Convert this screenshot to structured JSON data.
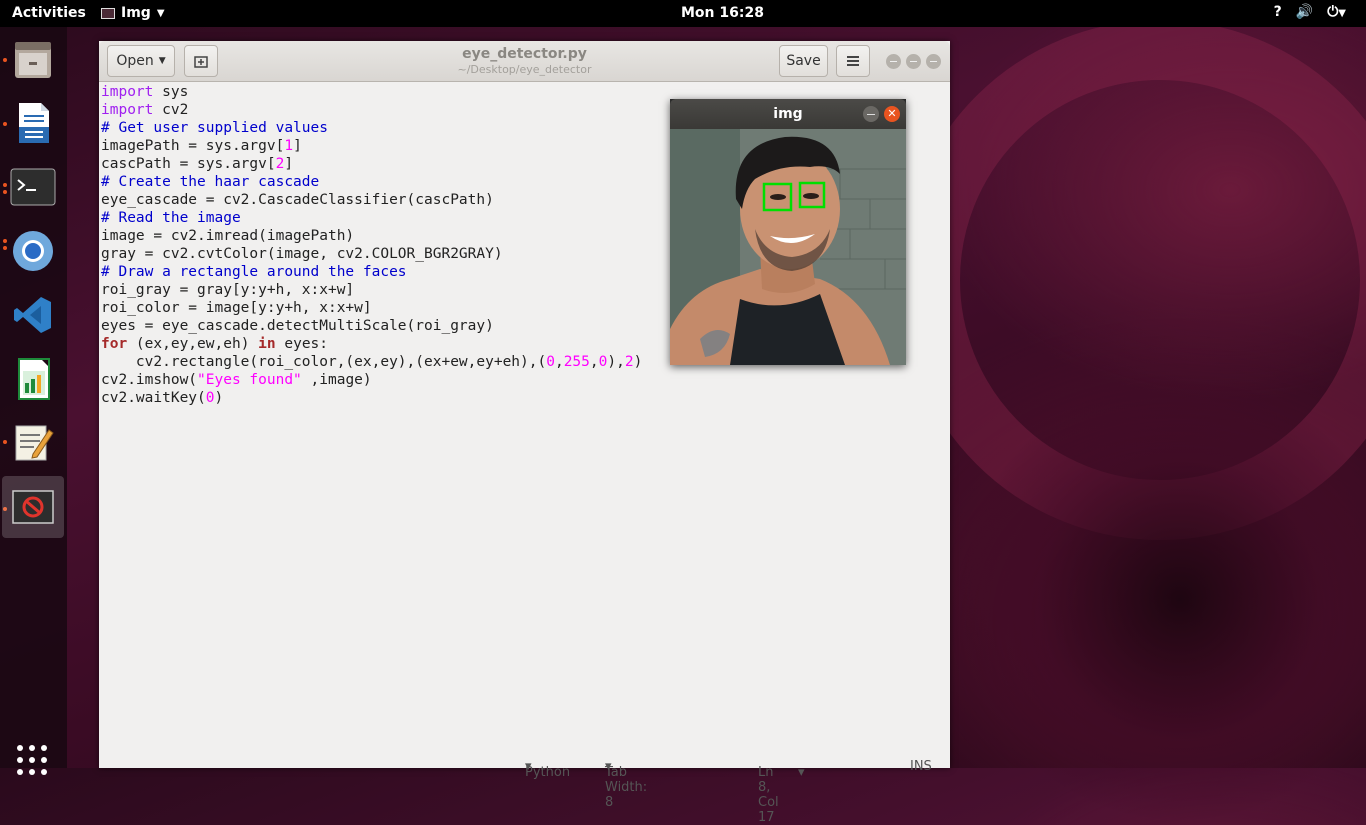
{
  "topbar": {
    "activities": "Activities",
    "app_name": "Img",
    "clock": "Mon 16:28",
    "tray": [
      "?",
      "🔊",
      "⏻"
    ]
  },
  "dock": {
    "apps": [
      "Files",
      "LibreOffice Writer",
      "Terminal",
      "Chromium",
      "Visual Studio Code",
      "LibreOffice Calc",
      "Text Editor",
      "Img"
    ]
  },
  "editor": {
    "open_label": "Open",
    "title": "eye_detector.py",
    "subtitle": "~/Desktop/eye_detector",
    "save_label": "Save",
    "status": {
      "language": "Python",
      "tab_width": "Tab Width: 8",
      "position": "Ln 8, Col 17",
      "mode": "INS"
    }
  },
  "code_lines": [
    [
      {
        "t": "import",
        "c": "kw"
      },
      {
        "t": " sys",
        "c": ""
      }
    ],
    [
      {
        "t": "import",
        "c": "kw"
      },
      {
        "t": " cv2",
        "c": ""
      }
    ],
    [
      {
        "t": "# Get user supplied values",
        "c": "cm"
      }
    ],
    [
      {
        "t": "imagePath = sys.argv[",
        "c": ""
      },
      {
        "t": "1",
        "c": "num"
      },
      {
        "t": "]",
        "c": ""
      }
    ],
    [
      {
        "t": "cascPath = sys.argv[",
        "c": ""
      },
      {
        "t": "2",
        "c": "num"
      },
      {
        "t": "]",
        "c": ""
      }
    ],
    [
      {
        "t": "# Create the haar cascade",
        "c": "cm"
      }
    ],
    [
      {
        "t": "eye_cascade = cv2.CascadeClassifier(cascPath)",
        "c": ""
      }
    ],
    [
      {
        "t": "# Read the image",
        "c": "cm"
      }
    ],
    [
      {
        "t": "image = cv2.imread(imagePath)",
        "c": ""
      }
    ],
    [
      {
        "t": "gray = cv2.cvtColor(image, cv2.COLOR_BGR2GRAY)",
        "c": ""
      }
    ],
    [
      {
        "t": "# Draw a rectangle around the faces",
        "c": "cm"
      }
    ],
    [
      {
        "t": "roi_gray = gray[y:y+h, x:x+w]",
        "c": ""
      }
    ],
    [
      {
        "t": "roi_color = image[y:y+h, x:x+w]",
        "c": ""
      }
    ],
    [
      {
        "t": "eyes = eye_cascade.detectMultiScale(roi_gray)",
        "c": ""
      }
    ],
    [
      {
        "t": "for",
        "c": "kwb"
      },
      {
        "t": " (ex,ey,ew,eh) ",
        "c": ""
      },
      {
        "t": "in",
        "c": "kwb"
      },
      {
        "t": " eyes:",
        "c": ""
      }
    ],
    [
      {
        "t": "    cv2.rectangle(roi_color,(ex,ey),(ex+ew,ey+eh),(",
        "c": ""
      },
      {
        "t": "0",
        "c": "num"
      },
      {
        "t": ",",
        "c": ""
      },
      {
        "t": "255",
        "c": "num"
      },
      {
        "t": ",",
        "c": ""
      },
      {
        "t": "0",
        "c": "num"
      },
      {
        "t": "),",
        "c": ""
      },
      {
        "t": "2",
        "c": "num"
      },
      {
        "t": ")",
        "c": ""
      }
    ],
    [
      {
        "t": "cv2.imshow(",
        "c": ""
      },
      {
        "t": "\"Eyes found\"",
        "c": "str"
      },
      {
        "t": " ,image)",
        "c": ""
      }
    ],
    [
      {
        "t": "cv2.waitKey(",
        "c": ""
      },
      {
        "t": "0",
        "c": "num"
      },
      {
        "t": ")",
        "c": ""
      }
    ]
  ],
  "img_window": {
    "title": "img"
  },
  "colors": {
    "accent": "#e95420",
    "detection_box": "#00e000"
  }
}
